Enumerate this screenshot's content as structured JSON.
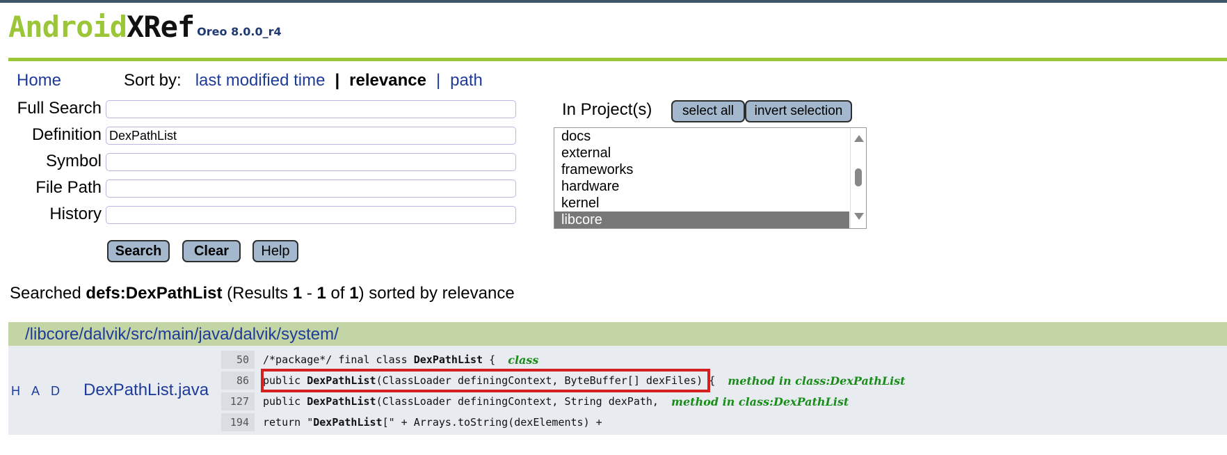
{
  "logo": {
    "part1": "Android",
    "part2": "XRef",
    "version": "Oreo 8.0.0_r4"
  },
  "nav": {
    "home": "Home",
    "sort_label": "Sort by:",
    "sort_last_modified": "last modified time",
    "sort_relevance": "relevance",
    "sort_path": "path",
    "separator": "|"
  },
  "form": {
    "full_search_label": "Full Search",
    "full_search_value": "",
    "definition_label": "Definition",
    "definition_value": "DexPathList",
    "symbol_label": "Symbol",
    "symbol_value": "",
    "file_path_label": "File Path",
    "file_path_value": "",
    "history_label": "History",
    "history_value": "",
    "search_button": "Search",
    "clear_button": "Clear",
    "help_button": "Help"
  },
  "projects": {
    "label": "In Project(s)",
    "select_all": "select all",
    "invert_selection": "invert selection",
    "items": [
      "docs",
      "external",
      "frameworks",
      "hardware",
      "kernel",
      "libcore"
    ],
    "selected": "libcore"
  },
  "summary": {
    "prefix": "Searched ",
    "query": "defs:DexPathList",
    "results_open": " (Results ",
    "from": "1",
    "dash": " - ",
    "to": "1",
    "of": " of ",
    "total": "1",
    "suffix": ") sorted by relevance"
  },
  "result": {
    "directory": "/libcore/dalvik/src/main/java/dalvik/system/",
    "had": "H A D",
    "file": "DexPathList.java",
    "lines": [
      {
        "num": "50",
        "pre": "/*package*/ final class ",
        "bold": "DexPathList",
        "post": " {  ",
        "tag": "class"
      },
      {
        "num": "86",
        "pre": "public ",
        "bold": "DexPathList",
        "post": "(ClassLoader definingContext, ByteBuffer[] dexFiles) {  ",
        "tag": "method in class:DexPathList"
      },
      {
        "num": "127",
        "pre": "public ",
        "bold": "DexPathList",
        "post": "(ClassLoader definingContext, String dexPath,  ",
        "tag": "method in class:DexPathList"
      },
      {
        "num": "194",
        "pre": "return \"",
        "bold": "DexPathList",
        "post": "[\" + Arrays.toString(dexElements) +",
        "tag": ""
      }
    ]
  },
  "colors": {
    "brand_green": "#9bc638",
    "link_blue": "#1f3b9a",
    "dir_bar": "#c3d5a5",
    "result_bg": "#e8ecf1",
    "highlight_red": "#d42020",
    "tag_green": "#1a8c1a"
  }
}
